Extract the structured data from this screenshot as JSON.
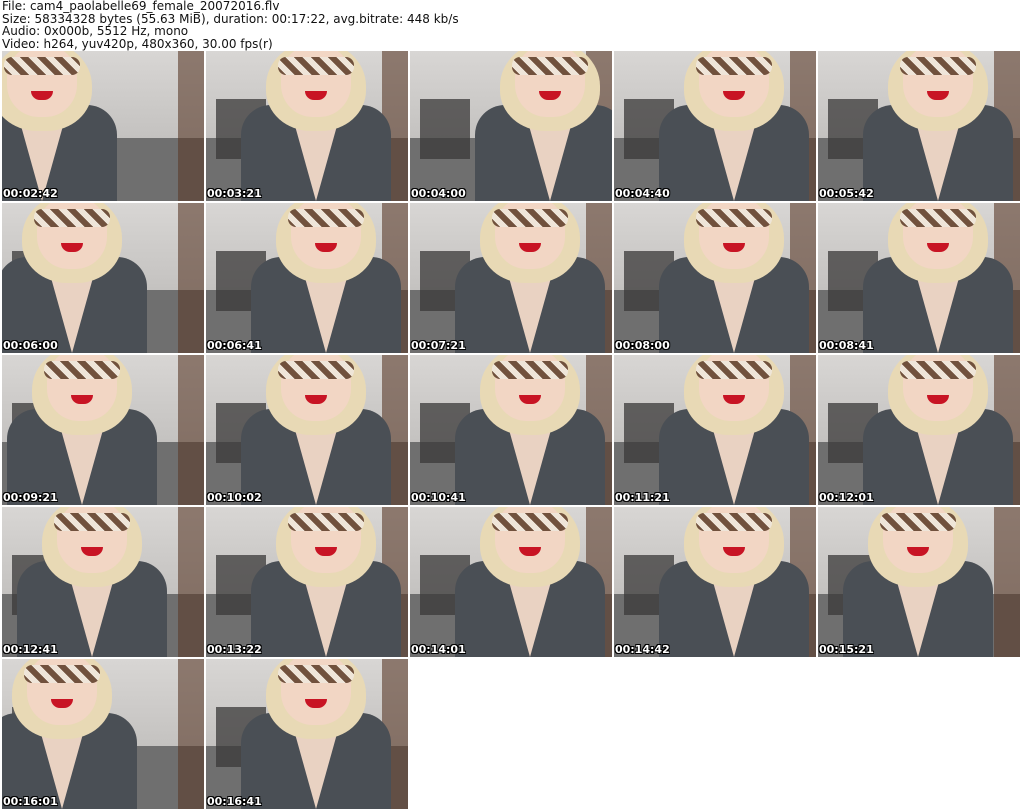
{
  "header": {
    "file": "File: cam4_paolabelle69_female_20072016.flv",
    "size": "Size: 58334328 bytes (55.63 MiB), duration: 00:17:22, avg.bitrate: 448 kb/s",
    "audio": "Audio: 0x000b, 5512 Hz, mono",
    "video": "Video: h264, yuv420p, 480x360, 30.00 fps(r)"
  },
  "thumbnails": [
    {
      "timestamp": "00:02:42"
    },
    {
      "timestamp": "00:03:21"
    },
    {
      "timestamp": "00:04:00"
    },
    {
      "timestamp": "00:04:40"
    },
    {
      "timestamp": "00:05:42"
    },
    {
      "timestamp": "00:06:00"
    },
    {
      "timestamp": "00:06:41"
    },
    {
      "timestamp": "00:07:21"
    },
    {
      "timestamp": "00:08:00"
    },
    {
      "timestamp": "00:08:41"
    },
    {
      "timestamp": "00:09:21"
    },
    {
      "timestamp": "00:10:02"
    },
    {
      "timestamp": "00:10:41"
    },
    {
      "timestamp": "00:11:21"
    },
    {
      "timestamp": "00:12:01"
    },
    {
      "timestamp": "00:12:41"
    },
    {
      "timestamp": "00:13:22"
    },
    {
      "timestamp": "00:14:01"
    },
    {
      "timestamp": "00:14:42"
    },
    {
      "timestamp": "00:15:21"
    },
    {
      "timestamp": "00:16:01"
    },
    {
      "timestamp": "00:16:41"
    }
  ]
}
